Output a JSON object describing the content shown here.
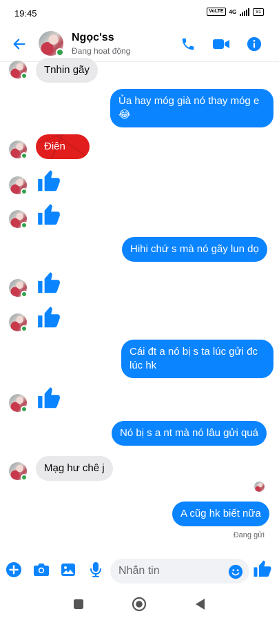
{
  "status_bar": {
    "time": "19:45",
    "volte": "VoLTE",
    "network": "4G",
    "battery": "91"
  },
  "header": {
    "contact_name": "Ngọc'ss",
    "contact_status": "Đang hoạt động"
  },
  "messages": [
    {
      "text": "Tnhin gãy"
    },
    {
      "text": "Ủa hay móg già nó thay móg e 😂"
    },
    {
      "text": "Điên"
    },
    {
      "text": "Hihi chứ s mà nó gãy lun dọ"
    },
    {
      "text": "Cái đt a nó bị s ta lúc gửi đc lúc hk"
    },
    {
      "text": "Nó bị s a nt mà nó lâu gửi quá"
    },
    {
      "text": "Mạg hư chê j"
    },
    {
      "text": "A cũg hk biết nữa"
    }
  ],
  "sent_status": "Đang gửi",
  "composer": {
    "placeholder": "Nhắn tin"
  },
  "colors": {
    "accent": "#0a84ff",
    "incoming_bubble": "#e9e9eb",
    "online": "#31a24c",
    "red_theme": "#e11d1d"
  },
  "icons": {
    "header": [
      "back-arrow-icon",
      "phone-icon",
      "video-camera-icon",
      "info-icon"
    ],
    "composer": [
      "plus-icon",
      "camera-icon",
      "image-icon",
      "microphone-icon",
      "emoji-icon",
      "thumbs-up-icon"
    ],
    "nav": [
      "recent-apps-icon",
      "home-icon",
      "back-icon"
    ]
  }
}
